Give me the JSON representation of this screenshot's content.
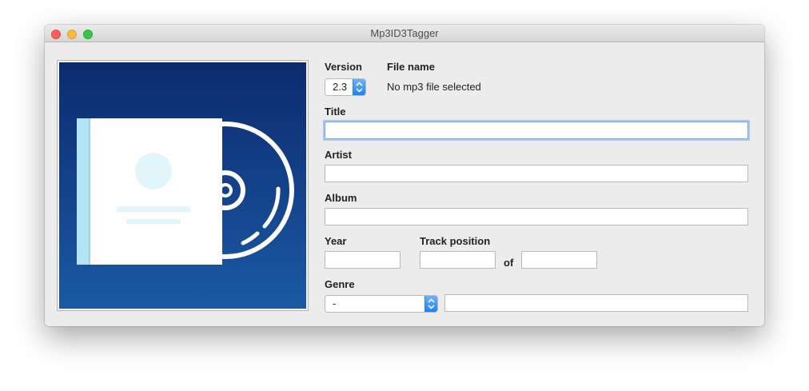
{
  "window": {
    "title": "Mp3ID3Tagger"
  },
  "colors": {
    "cover_top": "#0d2a6e",
    "cover_bottom": "#1a5aa4",
    "accent": "#1a82fb",
    "focus_ring": "#a9c9f3"
  },
  "cover": {
    "icon": "album-placeholder-icon"
  },
  "version": {
    "label": "Version",
    "value": "2.3"
  },
  "file": {
    "label": "File name",
    "value": "No mp3 file selected"
  },
  "title": {
    "label": "Title",
    "value": ""
  },
  "artist": {
    "label": "Artist",
    "value": ""
  },
  "album": {
    "label": "Album",
    "value": ""
  },
  "year": {
    "label": "Year",
    "value": ""
  },
  "track": {
    "label": "Track position",
    "of_label": "of",
    "value": "",
    "total": ""
  },
  "genre": {
    "label": "Genre",
    "selected": "-",
    "custom_value": ""
  }
}
